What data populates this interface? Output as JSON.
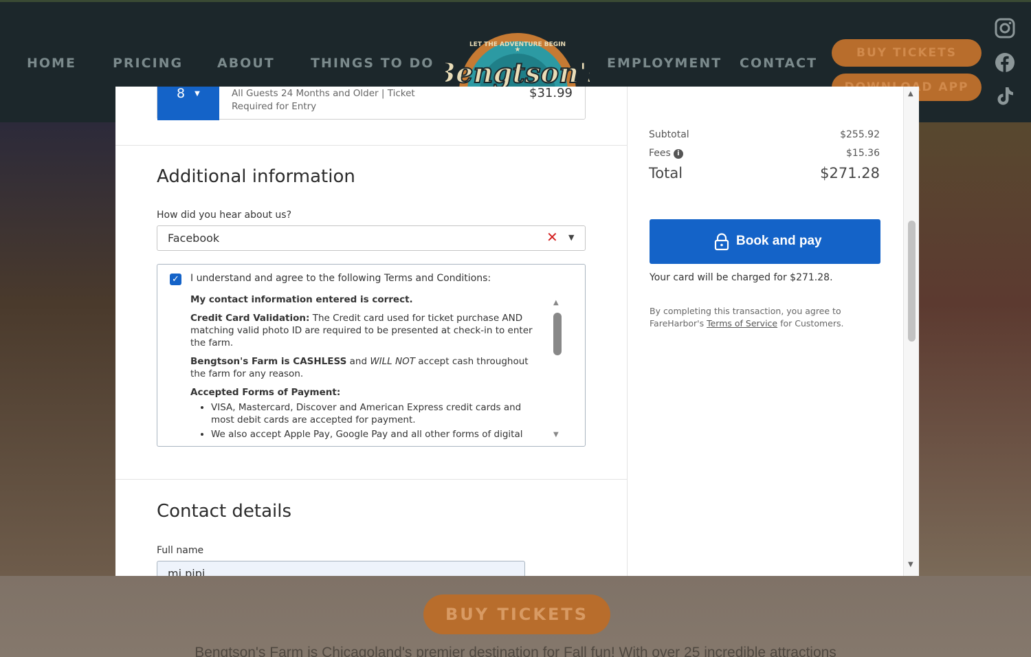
{
  "site": {
    "nav": [
      "HOME",
      "PRICING",
      "ABOUT",
      "THINGS TO DO",
      "EMPLOYMENT",
      "CONTACT"
    ],
    "logo_text": "Bengtson's",
    "logo_ring_text": "LET THE ADVENTURE BEGIN",
    "buy_tickets": "BUY TICKETS",
    "download_app": "DOWNLOAD APP",
    "social_icons": [
      "instagram-icon",
      "facebook-icon",
      "tiktok-icon"
    ],
    "bottom_buy_tickets": "BUY TICKETS",
    "bottom_text": "Bengtson's Farm is Chicagoland's premier destination for Fall fun! With over 25 incredible attractions"
  },
  "booking": {
    "ticket": {
      "quantity": "8",
      "description": "All Guests 24 Months and Older | Ticket Required for Entry",
      "price": "$31.99"
    },
    "additional_info": {
      "title": "Additional information",
      "question_label": "How did you hear about us?",
      "selected_value": "Facebook",
      "terms_checked": true,
      "terms_heading": "I understand and agree to the following Terms and Conditions:",
      "terms_p1": "My contact information entered is correct.",
      "terms_p2_bold": "Credit Card Validation:",
      "terms_p2_rest": " The Credit card used for ticket purchase AND matching valid photo ID are required to be presented at check-in to enter the farm.",
      "terms_p3_bold": "Bengtson's Farm is CASHLESS",
      "terms_p3_mid": " and ",
      "terms_p3_italic": "WILL NOT",
      "terms_p3_rest": " accept cash throughout the farm for any reason.",
      "terms_p4": "Accepted Forms of Payment:",
      "terms_li1": "VISA, Mastercard, Discover and American Express credit cards and most debit cards are accepted for payment.",
      "terms_li2": "We also accept Apple Pay, Google Pay and all other forms of digital"
    },
    "contact": {
      "title": "Contact details",
      "full_name_label": "Full name",
      "full_name_value": "mi pipi"
    },
    "summary": {
      "subtotal_label": "Subtotal",
      "subtotal_value": "$255.92",
      "fees_label": "Fees",
      "fees_value": "$15.36",
      "total_label": "Total",
      "total_value": "$271.28"
    },
    "book_button": "Book and pay",
    "charge_note": "Your card will be charged for $271.28.",
    "legal_prefix": "By completing this transaction, you agree to FareHarbor's ",
    "legal_link": "Terms of Service",
    "legal_suffix": " for Customers."
  },
  "colors": {
    "primary_blue": "#1463c8",
    "brand_orange": "#b86d2c",
    "header_dark": "#1c272b",
    "error_red": "#d42121"
  }
}
